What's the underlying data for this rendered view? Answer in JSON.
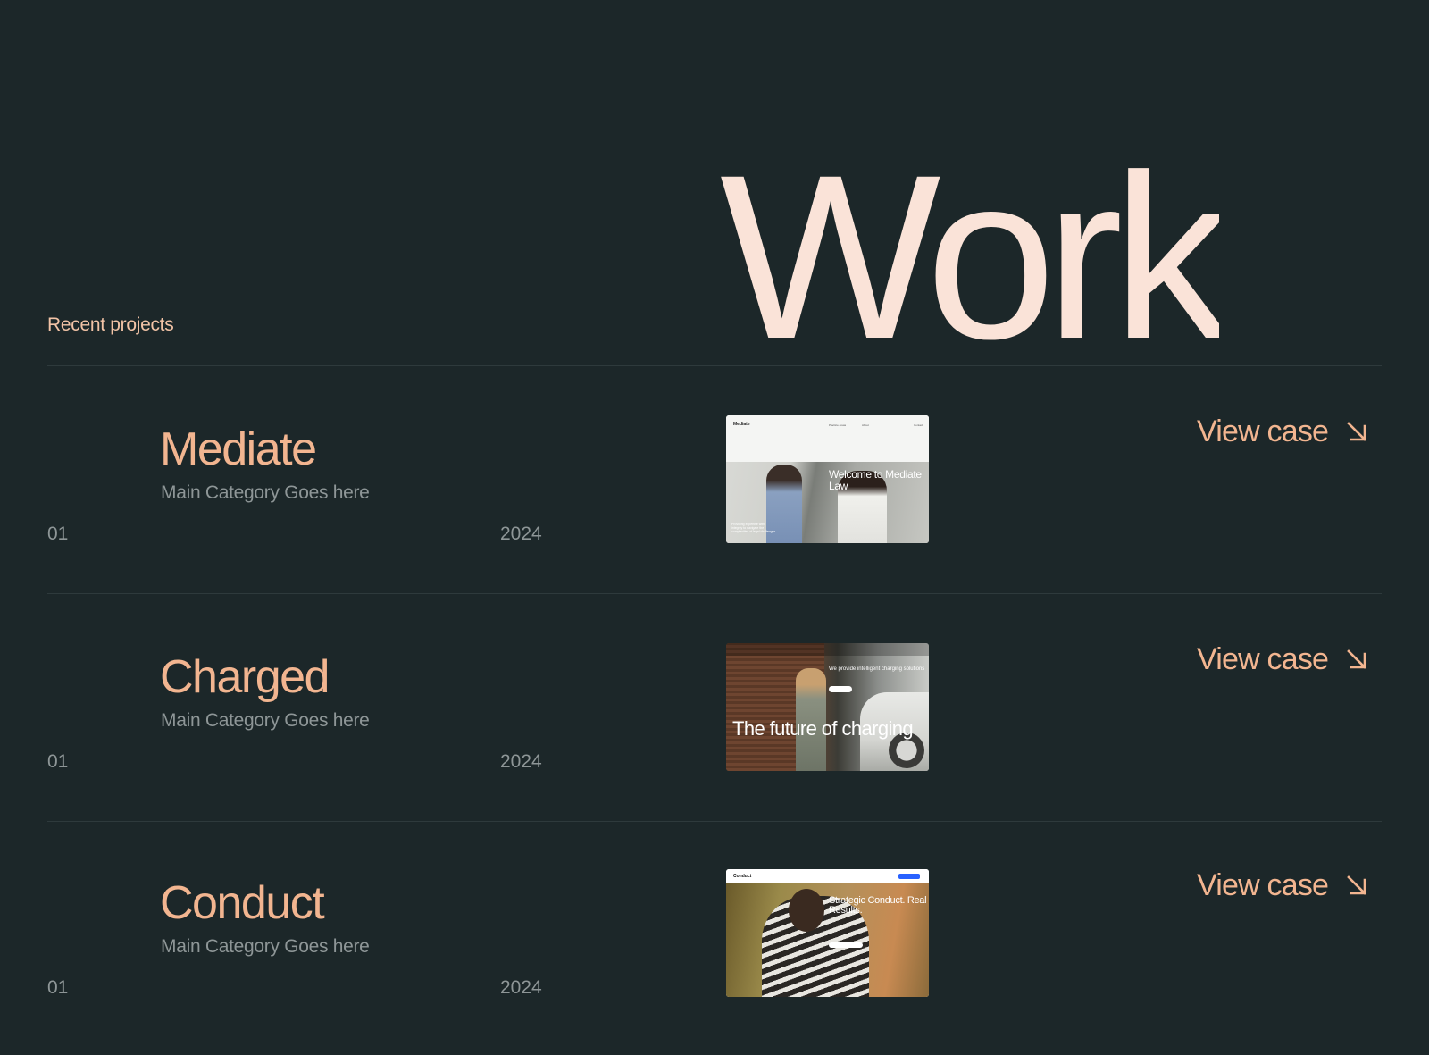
{
  "hero": {
    "title": "Work"
  },
  "section": {
    "label": "Recent projects"
  },
  "projects": [
    {
      "name": "Mediate",
      "category": "Main Category Goes here",
      "index": "01",
      "year": "2024",
      "cta": "View case",
      "thumbnail": {
        "logo": "Mediate",
        "nav": [
          "Practice areas",
          "About",
          "Contact"
        ],
        "headline": "Welcome to Mediate Law",
        "caption": "Providing expertise with integrity to navigate the complexities of legal challenges"
      }
    },
    {
      "name": "Charged",
      "category": "Main Category Goes here",
      "index": "01",
      "year": "2024",
      "cta": "View case",
      "thumbnail": {
        "headline": "The future of charging",
        "subline": "We provide intelligent charging solutions"
      }
    },
    {
      "name": "Conduct",
      "category": "Main Category Goes here",
      "index": "01",
      "year": "2024",
      "cta": "View case",
      "thumbnail": {
        "logo": "Conduct",
        "headline": "Strategic Conduct. Real Results."
      }
    }
  ],
  "icons": {
    "cta_icon": "arrow-down-right-icon"
  },
  "colors": {
    "background": "#1c2729",
    "hero": "#fae3d8",
    "accent": "#f2b590",
    "muted": "#8e9697"
  }
}
